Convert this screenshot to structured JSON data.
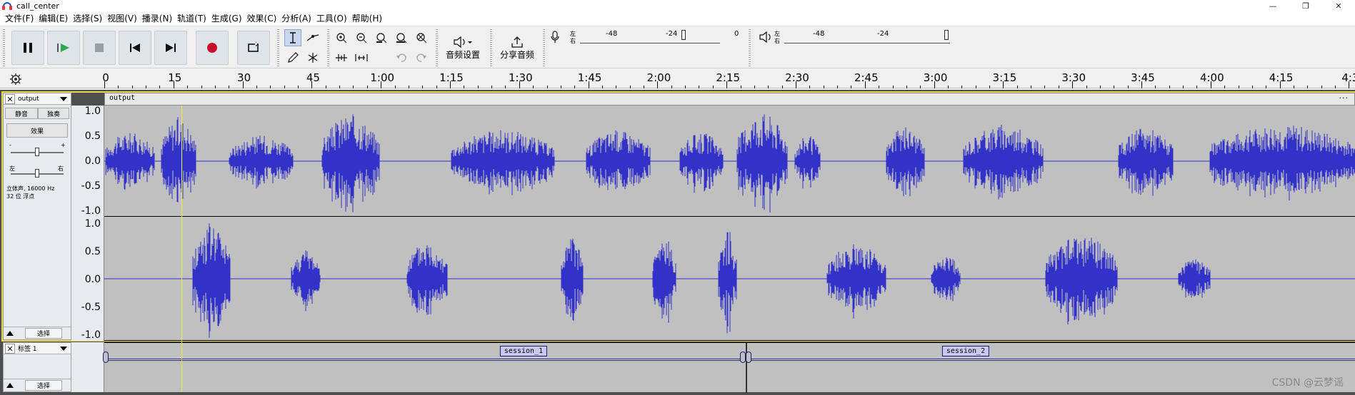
{
  "window": {
    "title": "call_center",
    "minimize": "—",
    "maximize": "❐",
    "close": "✕"
  },
  "menu": [
    "文件(F)",
    "编辑(E)",
    "选择(S)",
    "视图(V)",
    "播录(N)",
    "轨道(T)",
    "生成(G)",
    "效果(C)",
    "分析(A)",
    "工具(O)",
    "帮助(H)"
  ],
  "toolbar": {
    "audio_setup_label": "音频设置",
    "share_audio_label": "分享音频",
    "record_meter": {
      "lr": [
        "左",
        "右"
      ],
      "ticks": [
        "-48",
        "-24",
        "0"
      ]
    },
    "play_meter": {
      "lr": [
        "左",
        "右"
      ],
      "ticks": [
        "-48",
        "-24"
      ]
    },
    "colors": {
      "record_button": "#c8102e",
      "play_button": "#2fa84f"
    }
  },
  "ruler": {
    "labels": [
      "0",
      "15",
      "30",
      "45",
      "1:00",
      "1:15",
      "1:30",
      "1:45",
      "2:00",
      "2:15",
      "2:30",
      "2:45",
      "3:00",
      "3:15",
      "3:30",
      "3:45",
      "4:00",
      "4:15",
      "4:3"
    ]
  },
  "audio_track": {
    "name": "output",
    "clip_name": "output",
    "clip_menu": "···",
    "mute": "静音",
    "solo": "独奏",
    "effects": "效果",
    "gain_minus": "-",
    "gain_plus": "+",
    "pan_left": "左",
    "pan_right": "右",
    "info_line1": "立体声, 16000 Hz",
    "info_line2": "32 位 浮点",
    "select": "选择",
    "scale_labels": [
      "1.0",
      "0.5",
      "0.0",
      "-0.5",
      "-1.0"
    ],
    "colors": {
      "waveform": "#3232c8",
      "background": "#c0c0c0"
    }
  },
  "label_track": {
    "name": "标签 1",
    "select": "选择",
    "labels": [
      "session_1",
      "session_2"
    ]
  },
  "watermark": "CSDN @云梦谣"
}
